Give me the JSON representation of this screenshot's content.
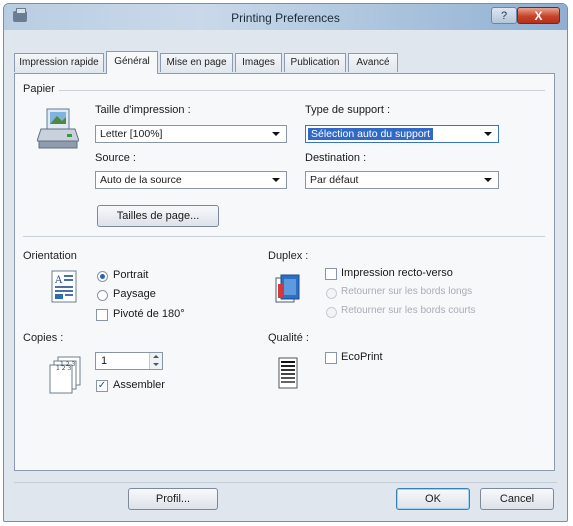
{
  "window": {
    "title": "Printing Preferences",
    "help_label": "?",
    "close_label": "X"
  },
  "tabs": [
    {
      "label": "Impression rapide",
      "active": false
    },
    {
      "label": "Général",
      "active": true
    },
    {
      "label": "Mise en page",
      "active": false
    },
    {
      "label": "Images",
      "active": false
    },
    {
      "label": "Publication",
      "active": false
    },
    {
      "label": "Avancé",
      "active": false
    }
  ],
  "paper": {
    "group_title": "Papier",
    "print_size": {
      "label": "Taille d'impression :",
      "value": "Letter [100%]"
    },
    "media_type": {
      "label": "Type de support :",
      "value": "Sélection auto du support"
    },
    "source": {
      "label": "Source :",
      "value": "Auto de la source"
    },
    "destination": {
      "label": "Destination :",
      "value": "Par défaut"
    },
    "page_sizes_button": "Tailles de page..."
  },
  "orientation": {
    "group_title": "Orientation",
    "portrait": "Portrait",
    "landscape": "Paysage",
    "rotate": "Pivoté de 180°",
    "selected": "portrait",
    "rotate_checked": false
  },
  "duplex": {
    "group_title": "Duplex :",
    "two_sided": "Impression recto-verso",
    "two_sided_checked": false,
    "flip_long": "Retourner sur les bords longs",
    "flip_short": "Retourner sur les bords courts"
  },
  "copies": {
    "group_title": "Copies :",
    "count": "1",
    "collate": "Assembler",
    "collate_checked": true,
    "check_mark": "✓"
  },
  "quality": {
    "group_title": "Qualité :",
    "ecoprint": "EcoPrint",
    "ecoprint_checked": false
  },
  "footer": {
    "profile_button": "Profil...",
    "ok_button": "OK",
    "cancel_button": "Cancel"
  },
  "icons": {
    "printer": "printer-icon",
    "orientation": "portrait-page-icon",
    "copies": "copies-stack-icon",
    "duplex": "duplex-pages-icon",
    "quality": "quality-gradient-icon"
  },
  "colors": {
    "focus_select": "#3169c6",
    "titlebar_start": "#b9cde2",
    "close_button": "#c8432a"
  }
}
